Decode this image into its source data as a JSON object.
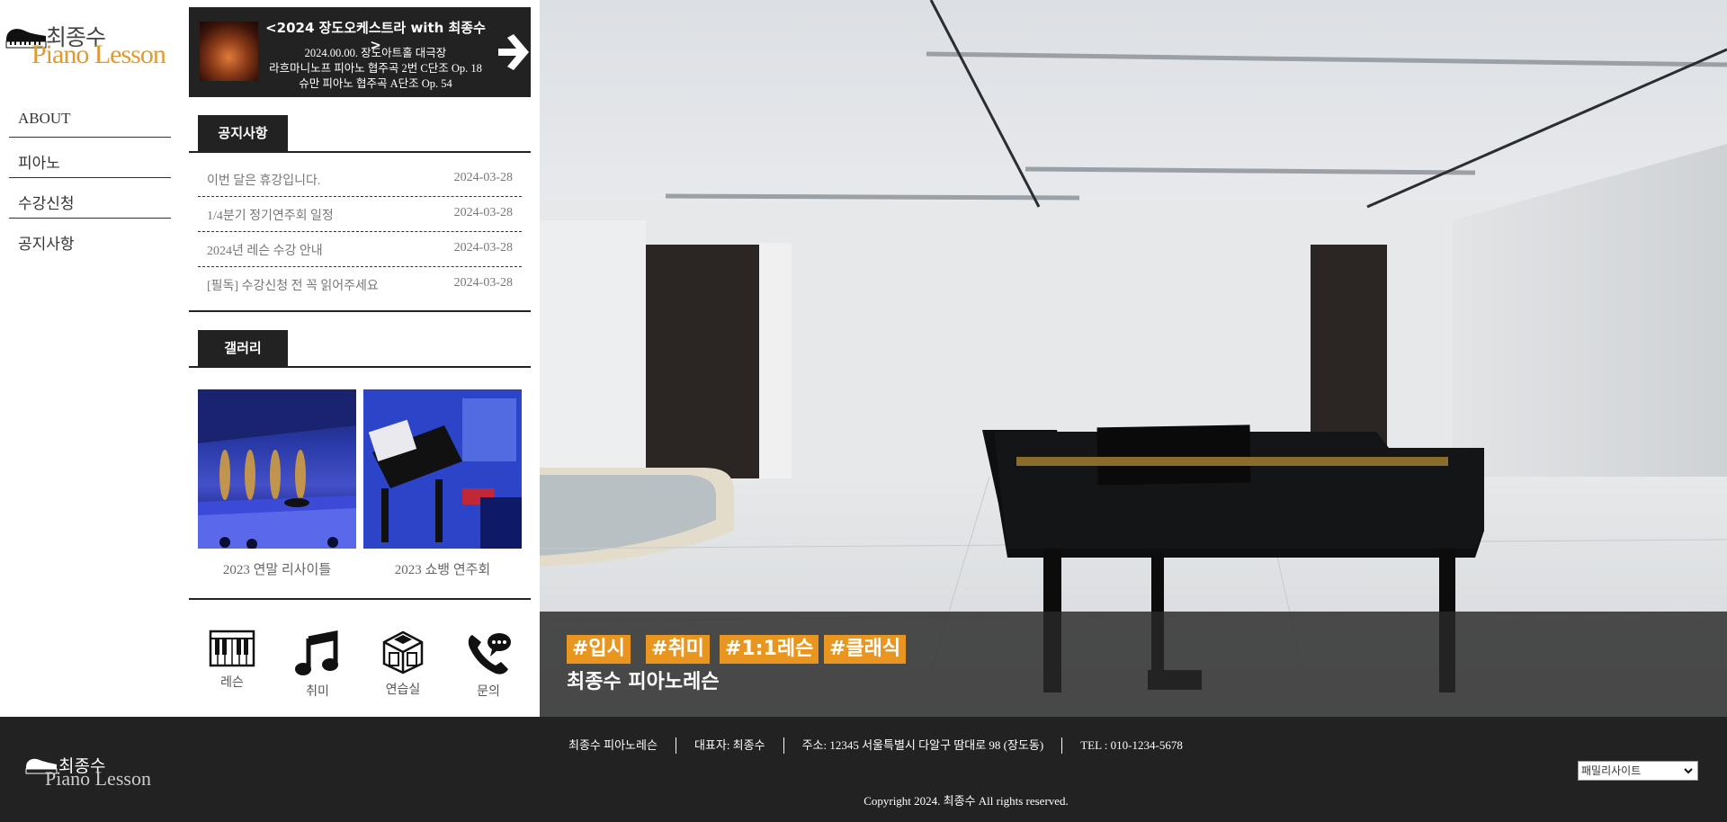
{
  "logo": {
    "kr": "최종수",
    "en": "Piano Lesson"
  },
  "menu": [
    {
      "label": "ABOUT"
    },
    {
      "label": "피아노"
    },
    {
      "label": "수강신청"
    },
    {
      "label": "공지사항"
    }
  ],
  "banner": {
    "title": "<2024 장도오케스트라 with 최종수>",
    "line1": "2024.00.00. 장도아트홀 대극장",
    "line2": "라흐마니노프 피아노 협주곡 2번 C단조 Op. 18",
    "line3": "슈만 피아노 협주곡 A단조 Op. 54"
  },
  "notice": {
    "heading": "공지사항",
    "items": [
      {
        "title": "이번 달은 휴강입니다.",
        "date": "2024-03-28"
      },
      {
        "title": "1/4분기 정기연주회 일정",
        "date": "2024-03-28"
      },
      {
        "title": "2024년 레슨 수강 안내",
        "date": "2024-03-28"
      },
      {
        "title": "[필독] 수강신청 전 꼭 읽어주세요",
        "date": "2024-03-28"
      }
    ]
  },
  "gallery": {
    "heading": "갤러리",
    "items": [
      {
        "caption": "2023 연말 리사이틀"
      },
      {
        "caption": "2023 쇼뱅 연주회"
      }
    ]
  },
  "quick_links": [
    {
      "label": "레슨",
      "icon": "piano-keys-icon"
    },
    {
      "label": "취미",
      "icon": "music-note-icon"
    },
    {
      "label": "연습실",
      "icon": "practice-room-icon"
    },
    {
      "label": "문의",
      "icon": "phone-chat-icon"
    }
  ],
  "hero": {
    "tags": [
      "#입시",
      "#취미",
      "#1:1레슨",
      "#클래식"
    ],
    "title": "최종수 피아노레슨"
  },
  "footer": {
    "logo_kr": "최종수",
    "logo_en": "Piano Lesson",
    "info": [
      "최종수 피아노레슨",
      "대표자: 최종수",
      "주소: 12345 서울특별시 다알구 땀대로 98 (장도동)",
      "TEL : 010-1234-5678"
    ],
    "copyright": "Copyright 2024. 최종수 All rights reserved.",
    "family_site": "패밀리사이트"
  },
  "colors": {
    "accent": "#e8961f",
    "dark": "#222222",
    "logo_orange": "#e29a2e"
  }
}
